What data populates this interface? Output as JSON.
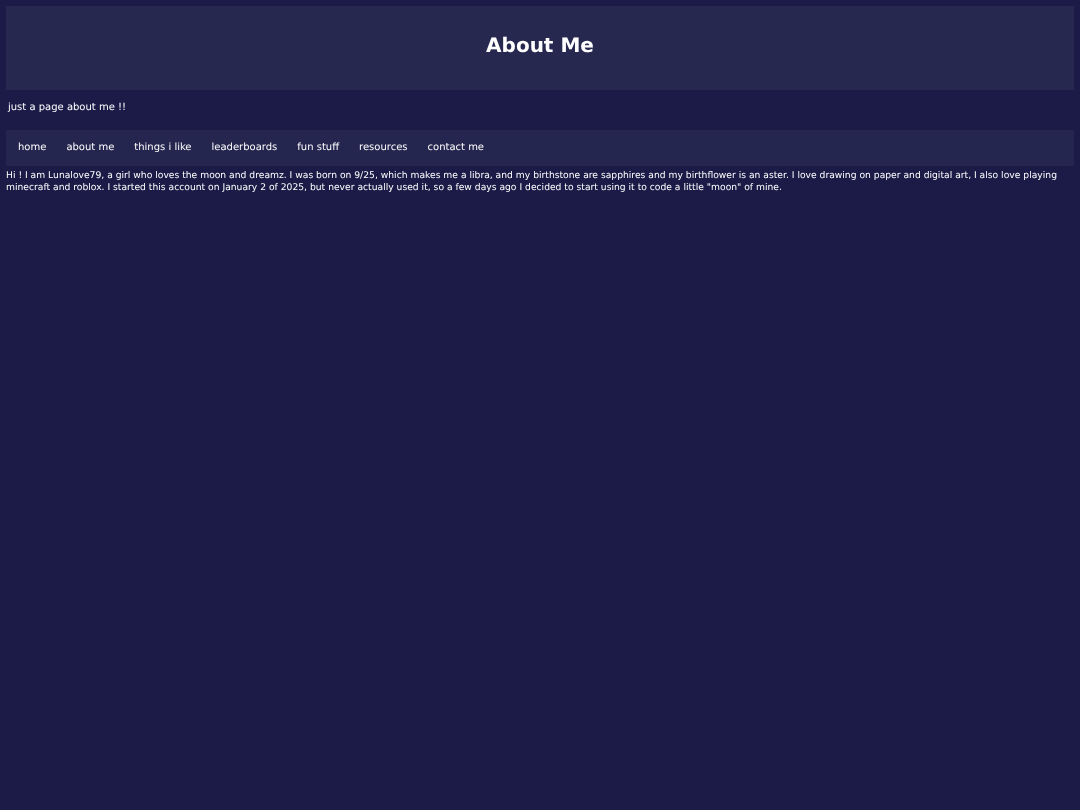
{
  "header": {
    "title": "About Me"
  },
  "subtitle": "just a page about me !!",
  "nav": [
    {
      "label": "home"
    },
    {
      "label": "about me"
    },
    {
      "label": "things i like"
    },
    {
      "label": "leaderboards"
    },
    {
      "label": "fun stuff"
    },
    {
      "label": "resources"
    },
    {
      "label": "contact me"
    }
  ],
  "body": "Hi ! I am Lunalove79, a girl who loves the moon and dreamz. I was born on 9/25, which makes me a libra, and my birthstone are sapphires and my birthflower is an aster. I love drawing on paper and digital art, I also love playing minecraft and roblox. I started this account on January 2 of 2025, but never actually used it, so a few days ago I decided to start using it to code a little \"moon\" of mine."
}
